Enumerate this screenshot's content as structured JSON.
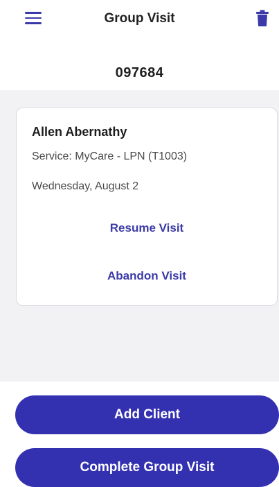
{
  "header": {
    "title": "Group Visit",
    "menu_icon": "hamburger-menu-icon",
    "delete_icon": "trash-icon"
  },
  "group": {
    "id": "097684"
  },
  "visit_card": {
    "client_name": "Allen Abernathy",
    "service": "Service: MyCare - LPN (T1003)",
    "date": "Wednesday, August 2",
    "resume_label": "Resume Visit",
    "abandon_label": "Abandon Visit"
  },
  "actions": {
    "add_client_label": "Add Client",
    "complete_label": "Complete Group Visit"
  },
  "colors": {
    "accent": "#3431b1",
    "link": "#3b3aa8",
    "list_background": "#f2f2f4"
  }
}
